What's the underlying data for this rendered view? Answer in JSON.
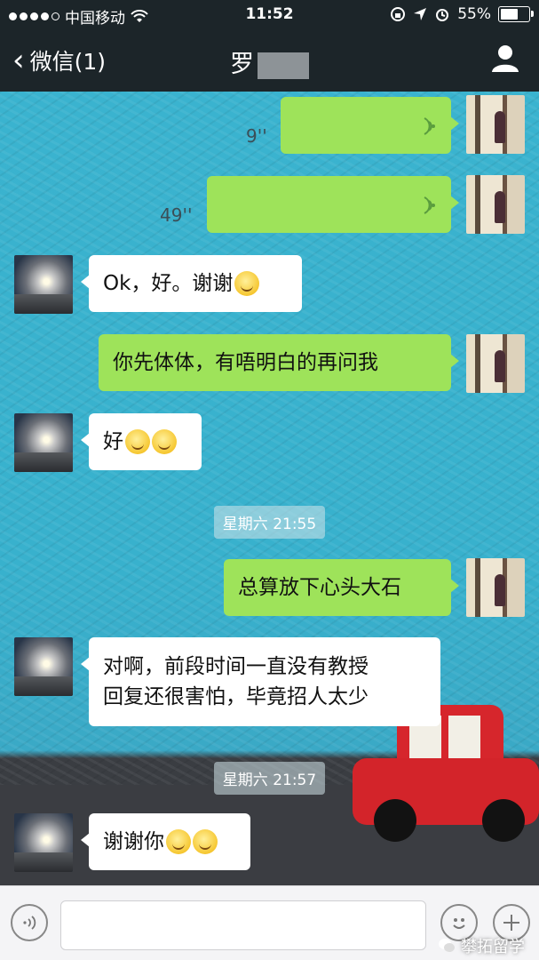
{
  "status_bar": {
    "carrier": "中国移动",
    "time": "11:52",
    "battery": "55%"
  },
  "nav": {
    "back_label": "微信(1)",
    "title": "罗"
  },
  "messages": {
    "voice1_duration": "9''",
    "voice2_duration": "49''",
    "msg3_text": "Ok，好。谢谢",
    "msg4_text": "你先体体，有唔明白的再问我",
    "msg5_text": "好",
    "time1": "星期六 21:55",
    "msg6_text": "总算放下心头大石",
    "msg7_line1": "对啊，前段时间一直没有教授",
    "msg7_line2": "回复还很害怕，毕竟招人太少",
    "time2": "星期六 21:57",
    "msg8_text": "谢谢你"
  },
  "watermark": "攀拓留学",
  "colors": {
    "outgoing_bubble": "#9ee35a",
    "incoming_bubble": "#ffffff",
    "nav_bg": "#1c2529",
    "chat_bg": "#38b1cd"
  },
  "icons": {
    "voice_wave": "voice-wave-icon",
    "profile": "person-icon",
    "voice_input": "voice-input-icon",
    "emoji": "emoji-icon",
    "more": "plus-icon"
  }
}
